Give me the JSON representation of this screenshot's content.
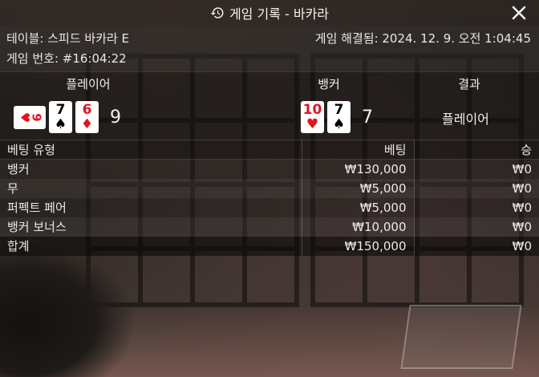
{
  "header": {
    "title": "게임 기록 - 바카라",
    "icon": "history-icon",
    "close_icon": "close-icon"
  },
  "info": {
    "table": "테이블: 스피드 바카라 E",
    "resolved": "게임 해결됨: 2024. 12. 9. 오전 1:04:45",
    "game_number": "게임 번호: #16:04:22"
  },
  "result": {
    "player_label": "플레이어",
    "banker_label": "뱅커",
    "result_label": "결과",
    "player_cards": [
      {
        "rank": "9",
        "suit": "♥",
        "color": "red",
        "sideways": true
      },
      {
        "rank": "7",
        "suit": "♠",
        "color": "black",
        "sideways": false
      },
      {
        "rank": "6",
        "suit": "♦",
        "color": "red",
        "sideways": false
      }
    ],
    "banker_cards": [
      {
        "rank": "10",
        "suit": "♥",
        "color": "red",
        "sideways": false
      },
      {
        "rank": "7",
        "suit": "♠",
        "color": "black",
        "sideways": false
      }
    ],
    "player_score": "9",
    "banker_score": "7",
    "winner": "플레이어"
  },
  "bets": {
    "headers": [
      "베팅 유형",
      "베팅",
      "승"
    ],
    "rows": [
      [
        "뱅커",
        "₩130,000",
        "₩0"
      ],
      [
        "무",
        "₩5,000",
        "₩0"
      ],
      [
        "퍼펙트 페어",
        "₩5,000",
        "₩0"
      ],
      [
        "뱅커 보너스",
        "₩10,000",
        "₩0"
      ]
    ],
    "total": [
      "합계",
      "₩150,000",
      "₩0"
    ]
  }
}
